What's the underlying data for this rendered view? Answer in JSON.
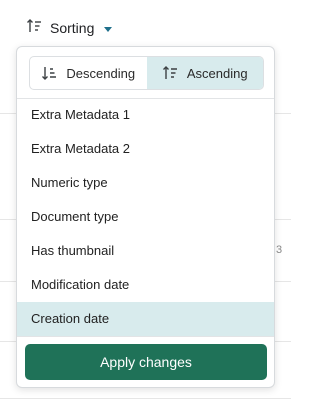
{
  "sort": {
    "label": "Sorting",
    "icon": "sort-ascending-icon",
    "caret_icon": "caret-down-icon",
    "accent_color": "#1f6f8b"
  },
  "order": {
    "descending_label": "Descending",
    "ascending_label": "Ascending",
    "selected": "Ascending",
    "selected_bg": "#d8ebed"
  },
  "fields": [
    {
      "label": "Extra Metadata 1",
      "selected": false
    },
    {
      "label": "Extra Metadata 2",
      "selected": false
    },
    {
      "label": "Numeric type",
      "selected": false
    },
    {
      "label": "Document type",
      "selected": false
    },
    {
      "label": "Has thumbnail",
      "selected": false
    },
    {
      "label": "Modification date",
      "selected": false
    },
    {
      "label": "Creation date",
      "selected": true
    }
  ],
  "apply": {
    "label": "Apply changes",
    "color": "#1f7258"
  },
  "background": {
    "partial_text": "3"
  }
}
